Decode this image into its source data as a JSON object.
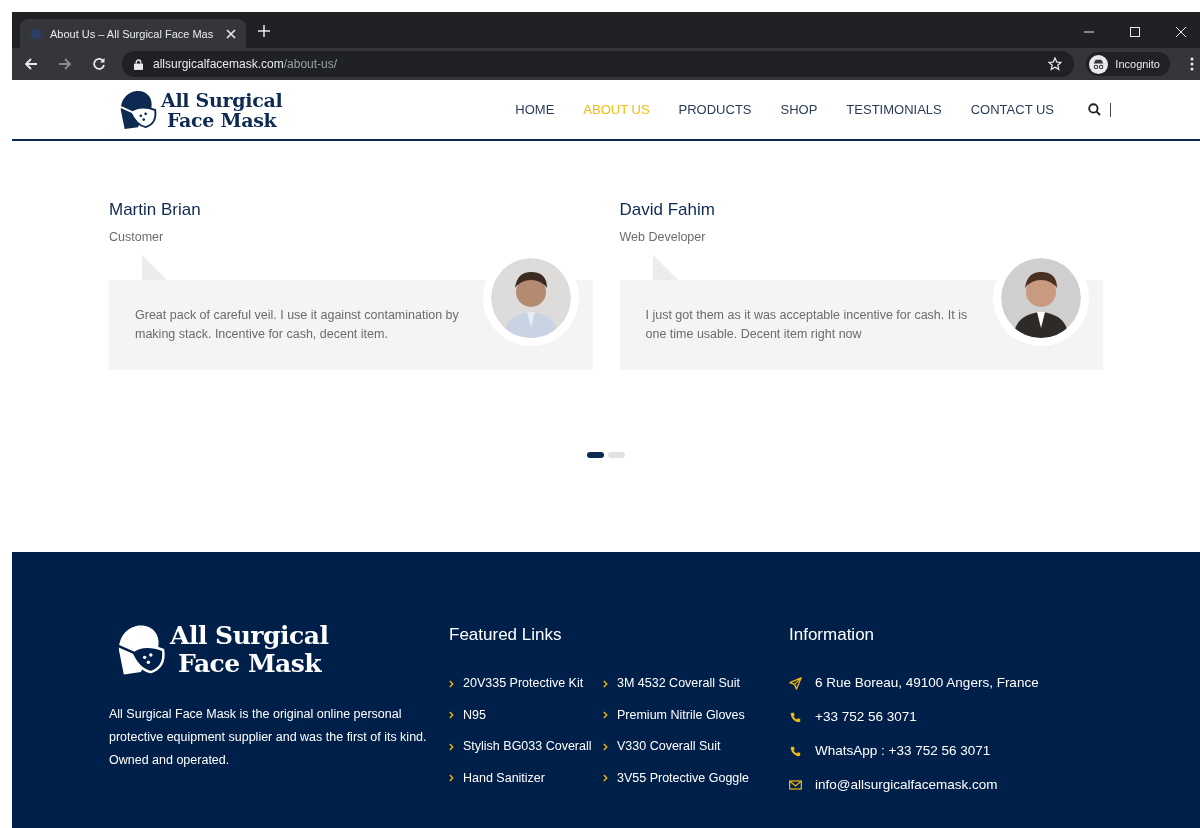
{
  "browser": {
    "tab_title": "About Us – All Surgical Face Mas",
    "url_host": "allsurgicalfacemask.com",
    "url_path": "/about-us/",
    "profile": "Incognito"
  },
  "header": {
    "logo_line1": "All Surgical",
    "logo_line2": "Face Mask",
    "nav": [
      {
        "label": "HOME",
        "selected": false
      },
      {
        "label": "ABOUT US",
        "selected": true
      },
      {
        "label": "PRODUCTS",
        "selected": false
      },
      {
        "label": "SHOP",
        "selected": false
      },
      {
        "label": "TESTIMONIALS",
        "selected": false
      },
      {
        "label": "CONTACT US",
        "selected": false
      }
    ]
  },
  "testimonials": {
    "items": [
      {
        "name": "Martin Brian",
        "role": "Customer",
        "quote": "Great pack of careful veil. I use it against contamination by making stack. Incentive for cash, decent item."
      },
      {
        "name": "David Fahim",
        "role": "Web Developer",
        "quote": "I just got them as it was acceptable incentive for cash. It is one time usable. Decent item right now"
      }
    ],
    "dots": [
      {
        "selected": true
      },
      {
        "selected": false
      }
    ]
  },
  "footer": {
    "logo_line1": "All Surgical",
    "logo_line2": "Face Mask",
    "about": "All Surgical Face Mask is the original online personal protective equipment supplier and was the first of its kind. Owned and operated.",
    "links_title": "Featured Links",
    "links": [
      "20V335 Protective Kit",
      "3M 4532 Coverall Suit",
      "N95",
      "Premium Nitrile Gloves",
      "Stylish BG033 Coverall",
      "V330 Coverall Suit",
      "Hand Sanitizer",
      "3V55 Protective Goggle"
    ],
    "info_title": "Information",
    "info": [
      {
        "kind": "address",
        "text": "6 Rue Boreau, 49100 Angers, France"
      },
      {
        "kind": "phone",
        "text": "+33 752 56 3071"
      },
      {
        "kind": "phone",
        "text": "WhatsApp : +33 752 56 3071"
      },
      {
        "kind": "email",
        "text": "info@allsurgicalfacemask.com"
      }
    ]
  }
}
